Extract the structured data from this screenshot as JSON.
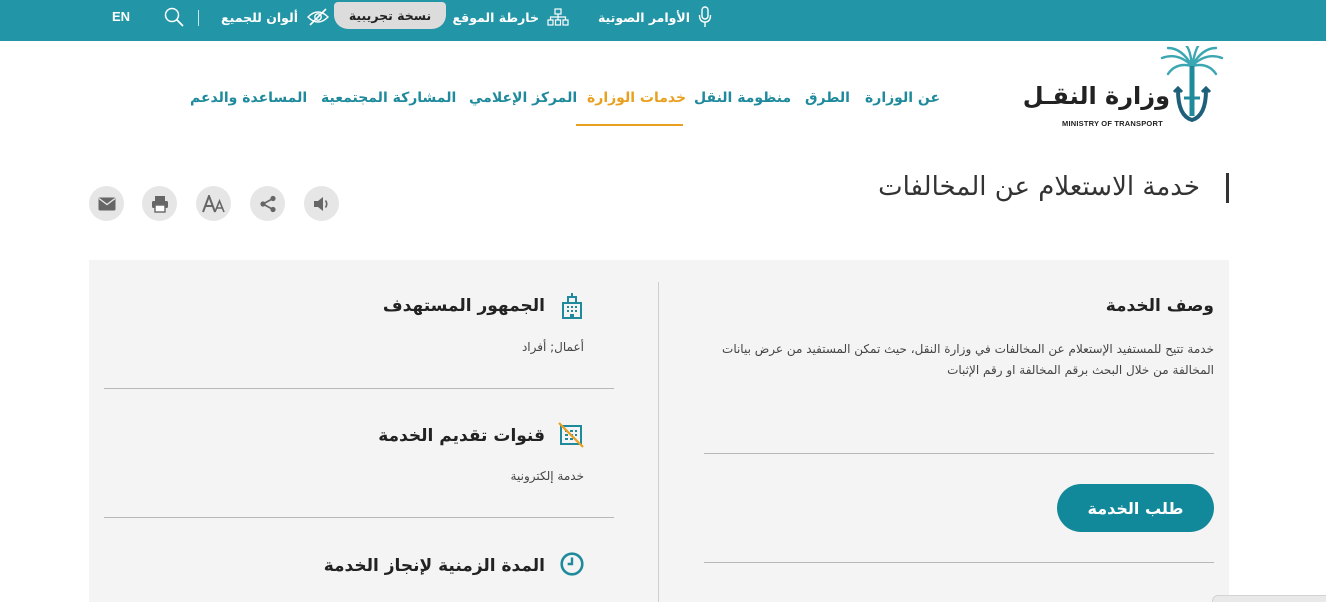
{
  "topbar": {
    "voice_commands": "الأوامر الصوتية",
    "sitemap": "خارطة الموقع",
    "beta": "نسخة تجريبية",
    "colors_for_all": "ألوان للجميع",
    "lang": "EN",
    "icons": [
      "microphone-icon",
      "sitemap-icon",
      "eye-slash-icon",
      "search-icon"
    ]
  },
  "logo": {
    "ar": "وزارة النقـل",
    "en": "MINISTRY OF TRANSPORT"
  },
  "nav": {
    "items": [
      {
        "label": "عن الوزارة"
      },
      {
        "label": "الطرق"
      },
      {
        "label": "منظومة النقل"
      },
      {
        "label": "خدمات الوزارة"
      },
      {
        "label": "المركز الإعلامي"
      },
      {
        "label": "المشاركة المجتمعية"
      },
      {
        "label": "المساعدة والدعم"
      }
    ],
    "active": "خدمات الوزارة"
  },
  "page": {
    "title": "خدمة الاستعلام عن المخالفات",
    "tools": [
      "speaker-icon",
      "share-icon",
      "font-size-icon",
      "print-icon",
      "email-icon"
    ]
  },
  "service": {
    "description_title": "وصف الخدمة",
    "description_text": "خدمة تتيح للمستفيد الإستعلام عن  المخالفات في وزارة النقل، حيث تمكن المستفيد من عرض بيانات المخالفة من خلال البحث برقم المخالفة او رقم الإثبات",
    "request_button": "طلب الخدمة",
    "audience_title": "الجمهور المستهدف",
    "audience_value": "أعمال; أفراد",
    "channels_title": "قنوات تقديم الخدمة",
    "channels_value": "خدمة إلكترونية",
    "duration_title": "المدة الزمنية لإنجاز الخدمة"
  },
  "colors": {
    "topbar": "#2295a7",
    "nav_text": "#1e8a9b",
    "active": "#e9a01f",
    "button": "#12899b",
    "panel": "#f4f4f4"
  }
}
